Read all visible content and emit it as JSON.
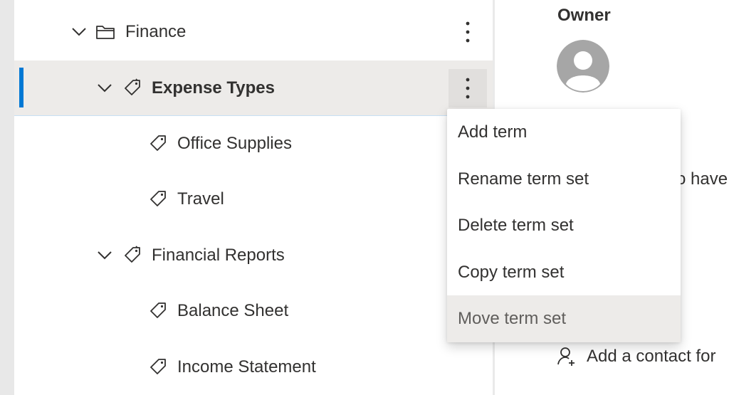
{
  "tree": {
    "items": [
      {
        "label": "Finance",
        "type": "term-group",
        "expanded": true,
        "level": 1
      },
      {
        "label": "Expense Types",
        "type": "term-set",
        "expanded": true,
        "level": 2,
        "selected": true
      },
      {
        "label": "Office Supplies",
        "type": "term",
        "level": 3
      },
      {
        "label": "Travel",
        "type": "term",
        "level": 3
      },
      {
        "label": "Financial Reports",
        "type": "term-set",
        "expanded": true,
        "level": 2
      },
      {
        "label": "Balance Sheet",
        "type": "term",
        "level": 3
      },
      {
        "label": "Income Statement",
        "type": "term",
        "level": 3
      }
    ]
  },
  "context_menu": {
    "items": [
      {
        "label": "Add term"
      },
      {
        "label": "Rename term set"
      },
      {
        "label": "Delete term set"
      },
      {
        "label": "Copy term set"
      },
      {
        "label": "Move term set"
      }
    ],
    "hovered": "Move term set"
  },
  "details": {
    "owner_title": "Owner",
    "partial_text": "o have",
    "add_contact_text": "Add a contact for"
  },
  "colors": {
    "accent": "#0078d4",
    "selected_row": "#edebe9",
    "text": "#323130"
  },
  "icons": [
    "chevron-down-icon",
    "folder-icon",
    "tag-icon",
    "more-vertical-icon",
    "avatar-icon",
    "add-contact-icon"
  ]
}
